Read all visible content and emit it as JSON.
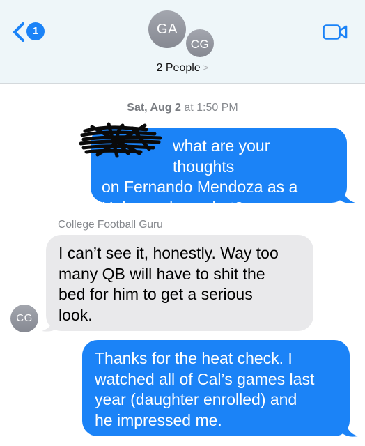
{
  "header": {
    "back_badge": "1",
    "avatars": [
      "GA",
      "CG"
    ],
    "title": "2 People",
    "title_chevron": ">"
  },
  "conversation": {
    "timestamp_day": "Sat, Aug 2",
    "timestamp_time": " at 1:50 PM",
    "messages": [
      {
        "direction": "outgoing",
        "lines": [
          "what are your thoughts",
          "on Fernando Mendoza as a",
          "Heisman long shot?"
        ],
        "redacted_prefix": true
      },
      {
        "direction": "incoming",
        "sender": "College Football Guru",
        "avatar": "CG",
        "lines": [
          "I can’t see it, honestly. Way too",
          "many QB will have to shit the",
          "bed for him to get a serious",
          "look."
        ]
      },
      {
        "direction": "outgoing",
        "lines": [
          "Thanks for the heat check. I",
          "watched all of Cal’s games last",
          "year (daughter enrolled) and",
          "he impressed me."
        ]
      }
    ]
  },
  "colors": {
    "outgoing_bubble": "#1b83f7",
    "incoming_bubble": "#e9e9eb",
    "header_bg": "#eef6f9",
    "accent": "#1b83f7"
  },
  "icons": {
    "back": "chevron-left-icon",
    "video": "video-camera-icon",
    "redaction": "scribble-redaction"
  }
}
